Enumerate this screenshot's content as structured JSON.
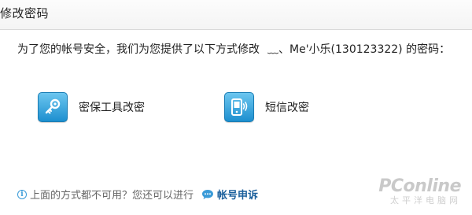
{
  "header": {
    "title": "修改密码"
  },
  "intro": {
    "text": "为了您的帐号安全，我们为您提供了以下方式修改",
    "nickname": "﹏、Me'小乐(130123322) 的密码："
  },
  "options": [
    {
      "label": "密保工具改密",
      "icon": "key-icon"
    },
    {
      "label": "短信改密",
      "icon": "phone-sms-icon"
    }
  ],
  "footer": {
    "text": "上面的方式都不可用？您还可以进行",
    "link": "帐号申诉"
  },
  "watermark": {
    "logo": "PConline",
    "sub": "太平洋电脑网"
  },
  "colors": {
    "icon_blue": "#1d8fcf",
    "link_blue": "#1a5f9c"
  }
}
